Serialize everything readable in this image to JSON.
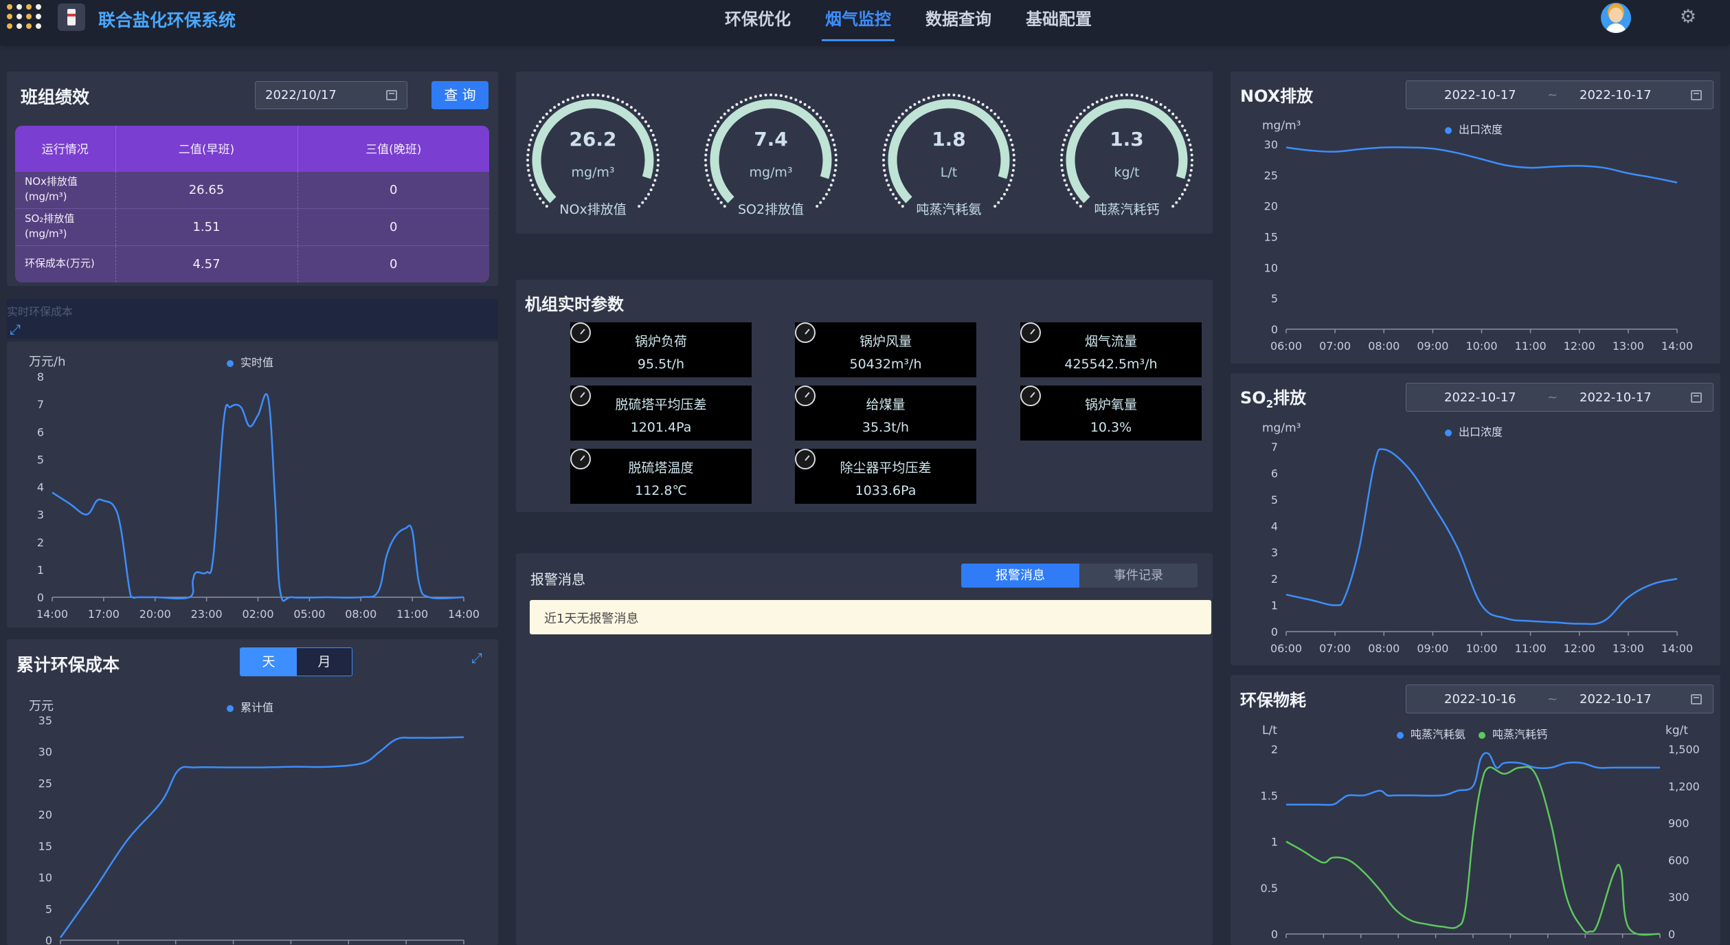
{
  "header": {
    "app_title": "联合盐化环保系统",
    "nav": [
      "环保优化",
      "烟气监控",
      "数据查询",
      "基础配置"
    ],
    "active_nav": "烟气监控",
    "logo_icon": "dot-grid-logo-icon",
    "app_icon": "factory-icon",
    "avatar_icon": "user-avatar-icon",
    "settings_icon": "gear-icon"
  },
  "team_perf": {
    "title": "班组绩效",
    "date": "2022/10/17",
    "query_label": "查 询",
    "columns": [
      "运行情况",
      "二值(早班)",
      "三值(晚班)"
    ],
    "rows": [
      {
        "label": "NOx排放值(mg/m³)",
        "v1": "26.65",
        "v2": "0"
      },
      {
        "label": "SO₂排放值(mg/m³)",
        "v1": "1.51",
        "v2": "0"
      },
      {
        "label": "环保成本(万元)",
        "v1": "4.57",
        "v2": "0"
      }
    ]
  },
  "realtime_cost": {
    "title": "实时环保成本",
    "y_unit": "万元/h",
    "legend": "实时值",
    "expand_icon": "expand-icon"
  },
  "cum_cost": {
    "title": "累计环保成本",
    "seg": [
      "天",
      "月"
    ],
    "active_seg": "天",
    "y_unit": "万元",
    "legend": "累计值",
    "expand_icon": "expand-icon"
  },
  "gauges": [
    {
      "value": "26.2",
      "unit": "mg/m³",
      "name": "NOx排放值",
      "fraction": 0.9
    },
    {
      "value": "7.4",
      "unit": "mg/m³",
      "name": "SO2排放值",
      "fraction": 0.9
    },
    {
      "value": "1.8",
      "unit": "L/t",
      "name": "吨蒸汽耗氨",
      "fraction": 0.9
    },
    {
      "value": "1.3",
      "unit": "kg/t",
      "name": "吨蒸汽耗钙",
      "fraction": 0.9
    }
  ],
  "params": {
    "title": "机组实时参数",
    "items": [
      {
        "name": "锅炉负荷",
        "value": "95.5t/h"
      },
      {
        "name": "锅炉风量",
        "value": "50432m³/h"
      },
      {
        "name": "烟气流量",
        "value": "425542.5m³/h"
      },
      {
        "name": "脱硫塔平均压差",
        "value": "1201.4Pa"
      },
      {
        "name": "给煤量",
        "value": "35.3t/h"
      },
      {
        "name": "锅炉氧量",
        "value": "10.3%"
      },
      {
        "name": "脱硫塔温度",
        "value": "112.8℃"
      },
      {
        "name": "除尘器平均压差",
        "value": "1033.6Pa"
      }
    ],
    "icon": "gauge-icon"
  },
  "alarm": {
    "title": "报警消息",
    "tabs": [
      "报警消息",
      "事件记录"
    ],
    "active_tab": "报警消息",
    "message": "近1天无报警消息"
  },
  "nox": {
    "title": "NOX排放",
    "date_from": "2022-10-17",
    "sep": "~",
    "date_to": "2022-10-17",
    "y_unit": "mg/m³",
    "legend": "出口浓度"
  },
  "so2": {
    "title_main": "SO",
    "title_sub": "2",
    "title_tail": "排放",
    "date_from": "2022-10-17",
    "sep": "~",
    "date_to": "2022-10-17",
    "y_unit": "mg/m³",
    "legend": "出口浓度"
  },
  "consume": {
    "title": "环保物耗",
    "date_from": "2022-10-16",
    "sep": "~",
    "date_to": "2022-10-17",
    "y_unit_left": "L/t",
    "y_unit_right": "kg/t",
    "legend": [
      "吨蒸汽耗氨",
      "吨蒸汽耗钙"
    ]
  },
  "colors": {
    "blue": "#3d8eff",
    "green": "#5ec85e",
    "purple_head": "#7a3ed0",
    "purple_row": "#54407f",
    "gauge_arc": "#bfe3d5"
  },
  "chart_data": [
    {
      "id": "realtime_cost",
      "type": "line",
      "ylabel": "万元/h",
      "ylim": [
        0,
        8
      ],
      "yticks": [
        0,
        1,
        2,
        3,
        4,
        5,
        6,
        7,
        8
      ],
      "xlabels": [
        "14:00",
        "17:00",
        "20:00",
        "23:00",
        "02:00",
        "05:00",
        "08:00",
        "11:00",
        "14:00"
      ],
      "xlim": [
        0,
        24
      ],
      "series": [
        {
          "name": "实时值",
          "color": "#3d8eff",
          "x": [
            0,
            1,
            2,
            2.6,
            3,
            3.6,
            4,
            4.5,
            4.7,
            5,
            6,
            8,
            8.2,
            8.4,
            9,
            9.4,
            10,
            10.4,
            11,
            11.5,
            12,
            12.6,
            13,
            13.3,
            14,
            16,
            18,
            19,
            19.5,
            20,
            20.6,
            21,
            21.4,
            22,
            24
          ],
          "y": [
            3.8,
            3.4,
            3.0,
            3.5,
            3.5,
            3.3,
            2.5,
            0.3,
            0,
            0,
            0,
            0,
            0.6,
            0.9,
            0.9,
            1.5,
            6.4,
            6.9,
            6.9,
            6.2,
            6.6,
            7.2,
            3.5,
            0.2,
            0,
            0,
            0,
            0.2,
            1.5,
            2.2,
            2.5,
            2.4,
            0.5,
            0,
            0
          ]
        }
      ]
    },
    {
      "id": "cum_cost",
      "type": "line",
      "ylabel": "万元",
      "ylim": [
        0,
        35
      ],
      "yticks": [
        0,
        5,
        10,
        15,
        20,
        25,
        30,
        35
      ],
      "xlim": [
        0,
        24
      ],
      "series": [
        {
          "name": "累计值",
          "color": "#3d8eff",
          "x": [
            0,
            2,
            4,
            6,
            7,
            8,
            10,
            12,
            14,
            16,
            18,
            19,
            20,
            21,
            22,
            24
          ],
          "y": [
            0.4,
            8,
            16,
            22,
            27,
            27.5,
            27.5,
            27.5,
            27.6,
            27.6,
            28.2,
            30,
            32,
            32.2,
            32.2,
            32.3
          ]
        }
      ]
    },
    {
      "id": "nox",
      "type": "line",
      "ylabel": "mg/m³",
      "ylim": [
        0,
        30
      ],
      "yticks": [
        0,
        5,
        10,
        15,
        20,
        25,
        30
      ],
      "xlabels": [
        "06:00",
        "07:00",
        "08:00",
        "09:00",
        "10:00",
        "11:00",
        "12:00",
        "13:00",
        "14:00"
      ],
      "xlim": [
        6,
        14
      ],
      "series": [
        {
          "name": "出口浓度",
          "color": "#3d8eff",
          "x": [
            6,
            6.5,
            7,
            7.5,
            8,
            8.5,
            9,
            9.5,
            10,
            10.5,
            11,
            11.5,
            12,
            12.5,
            13,
            13.5,
            14
          ],
          "y": [
            29.5,
            29,
            28.8,
            29.2,
            29.5,
            29.5,
            29.3,
            28.6,
            27.6,
            26.6,
            26.2,
            26.4,
            26.5,
            26.2,
            25.3,
            24.6,
            23.8
          ]
        }
      ]
    },
    {
      "id": "so2",
      "type": "line",
      "ylabel": "mg/m³",
      "ylim": [
        0,
        7
      ],
      "yticks": [
        0,
        1,
        2,
        3,
        4,
        5,
        6,
        7
      ],
      "xlabels": [
        "06:00",
        "07:00",
        "08:00",
        "09:00",
        "10:00",
        "11:00",
        "12:00",
        "13:00",
        "14:00"
      ],
      "xlim": [
        6,
        14
      ],
      "series": [
        {
          "name": "出口浓度",
          "color": "#3d8eff",
          "x": [
            6,
            6.5,
            7,
            7.2,
            7.5,
            7.8,
            8,
            8.5,
            9,
            9.5,
            10,
            10.5,
            11,
            11.5,
            12,
            12.5,
            13,
            13.5,
            14
          ],
          "y": [
            1.4,
            1.2,
            1.0,
            1.3,
            3.2,
            6.3,
            6.9,
            6.2,
            4.8,
            3.2,
            1.0,
            0.5,
            0.4,
            0.35,
            0.3,
            0.4,
            1.3,
            1.8,
            2.0
          ]
        }
      ]
    },
    {
      "id": "consume",
      "type": "line",
      "ylabel": "L/t",
      "ylim": [
        0,
        2
      ],
      "yticks": [
        0,
        0.5,
        1,
        1.5,
        2
      ],
      "y2label": "kg/t",
      "y2lim": [
        0,
        1500
      ],
      "y2ticks": [
        "0",
        "300",
        "600",
        "900",
        "1,200",
        "1,500"
      ],
      "xlim": [
        0,
        24
      ],
      "series": [
        {
          "name": "吨蒸汽耗氨",
          "color": "#3d8eff",
          "axis": "left",
          "x": [
            0,
            2,
            3,
            3.5,
            4,
            5,
            6,
            6.5,
            7,
            8,
            10,
            11,
            12,
            12.5,
            13,
            13.5,
            14,
            15,
            16,
            17,
            18,
            19,
            20,
            21,
            22,
            24
          ],
          "y": [
            1.4,
            1.4,
            1.4,
            1.45,
            1.5,
            1.5,
            1.55,
            1.5,
            1.5,
            1.5,
            1.5,
            1.55,
            1.6,
            1.9,
            1.95,
            1.8,
            1.85,
            1.85,
            1.8,
            1.8,
            1.85,
            1.85,
            1.8,
            1.8,
            1.8,
            1.8
          ]
        },
        {
          "name": "吨蒸汽耗钙",
          "color": "#5ec85e",
          "axis": "right",
          "x": [
            0,
            1,
            2,
            2.5,
            3,
            4,
            5,
            6,
            7,
            8,
            9,
            10,
            11,
            11.5,
            12,
            12.5,
            13,
            14,
            15,
            16,
            17,
            18,
            19,
            19.5,
            20,
            21,
            21.5,
            22,
            24
          ],
          "y": [
            750,
            680,
            600,
            580,
            620,
            600,
            500,
            360,
            200,
            110,
            80,
            60,
            60,
            200,
            800,
            1200,
            1350,
            1300,
            1350,
            1300,
            900,
            300,
            50,
            20,
            80,
            480,
            520,
            50,
            0
          ]
        }
      ]
    }
  ]
}
